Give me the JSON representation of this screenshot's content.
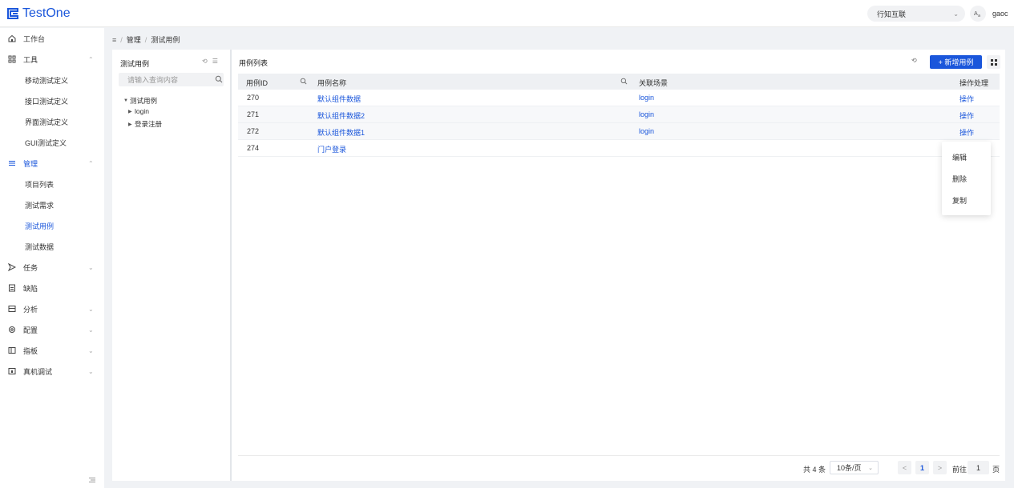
{
  "app": {
    "logo_text": "TestOne"
  },
  "header": {
    "org_name": "行知互联",
    "lang_icon": "translate-icon",
    "user_name": "gaoc"
  },
  "sidebar": {
    "items": [
      {
        "label": "工作台",
        "icon": "home-icon"
      },
      {
        "label": "工具",
        "icon": "grid-icon",
        "expanded": true,
        "children": [
          "移动测试定义",
          "接口测试定义",
          "界面测试定义",
          "GUI测试定义"
        ]
      },
      {
        "label": "管理",
        "icon": "list-icon",
        "expanded": true,
        "active": true,
        "children": [
          "项目列表",
          "测试需求",
          "测试用例",
          "测试数据"
        ]
      },
      {
        "label": "任务",
        "icon": "send-icon"
      },
      {
        "label": "缺陷",
        "icon": "file-icon"
      },
      {
        "label": "分析",
        "icon": "calendar-icon"
      },
      {
        "label": "配置",
        "icon": "gear-icon"
      },
      {
        "label": "指板",
        "icon": "panel-icon"
      },
      {
        "label": "真机调试",
        "icon": "device-icon"
      }
    ],
    "active_child": "测试用例"
  },
  "breadcrumb": {
    "menu_icon": "menu-icon",
    "items": [
      "管理",
      "测试用例"
    ]
  },
  "tree": {
    "title": "测试用例",
    "search_placeholder": "请输入查询内容",
    "nodes": [
      {
        "label": "测试用例",
        "expanded": true,
        "level": 0
      },
      {
        "label": "login",
        "level": 1
      },
      {
        "label": "登录注册",
        "level": 1
      }
    ]
  },
  "main": {
    "title": "用例列表",
    "add_button": "+ 新增用例",
    "columns": [
      "用例ID",
      "用例名称",
      "关联场景",
      "操作处理"
    ],
    "rows": [
      {
        "id": "270",
        "name": "默认组件数据",
        "scene": "login",
        "action": "操作"
      },
      {
        "id": "271",
        "name": "默认组件数据2",
        "scene": "login",
        "action": "操作"
      },
      {
        "id": "272",
        "name": "默认组件数据1",
        "scene": "login",
        "action": "操作"
      },
      {
        "id": "274",
        "name": "门户登录",
        "scene": "",
        "action": ""
      }
    ]
  },
  "dropdown": {
    "items": [
      "编辑",
      "删除",
      "复制"
    ]
  },
  "pagination": {
    "total": "共 4 条",
    "page_size": "10条/页",
    "prev": "<",
    "current": "1",
    "next": ">",
    "goto_label": "前往",
    "goto_value": "1",
    "unit": "页"
  },
  "colors": {
    "accent": "#1a56db",
    "background": "#f0f2f5"
  }
}
